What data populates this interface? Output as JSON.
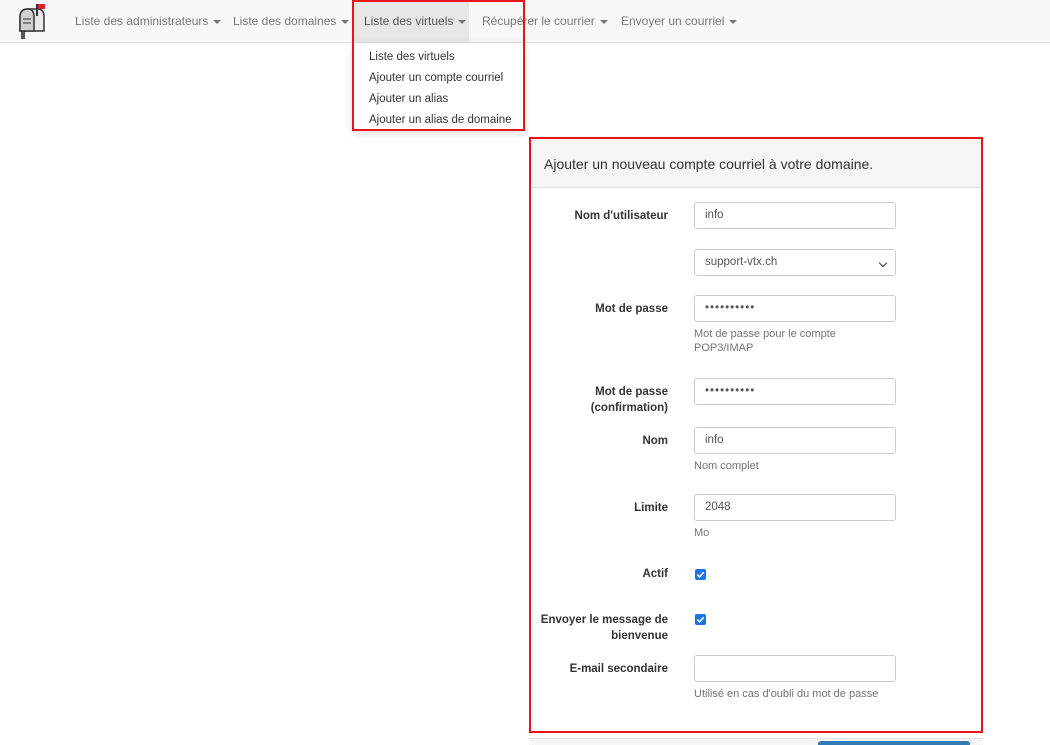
{
  "nav": {
    "items": [
      {
        "label": "Liste des administrateurs"
      },
      {
        "label": "Liste des domaines"
      },
      {
        "label": "Liste des virtuels"
      },
      {
        "label": "Récupérer le courrier"
      },
      {
        "label": "Envoyer un courriel"
      }
    ],
    "dropdown": [
      {
        "label": "Liste des virtuels"
      },
      {
        "label": "Ajouter un compte courriel"
      },
      {
        "label": "Ajouter un alias"
      },
      {
        "label": "Ajouter un alias de domaine"
      }
    ]
  },
  "form": {
    "title": "Ajouter un nouveau compte courriel à votre domaine.",
    "username": {
      "label": "Nom d'utilisateur",
      "value": "info"
    },
    "domain": {
      "value": "support-vtx.ch"
    },
    "password": {
      "label": "Mot de passe",
      "value": "••••••••••",
      "help": "Mot de passe pour le compte POP3/IMAP"
    },
    "password_confirm": {
      "label": "Mot de passe (confirmation)",
      "value": "••••••••••"
    },
    "name": {
      "label": "Nom",
      "value": "info",
      "help": "Nom complet"
    },
    "quota": {
      "label": "Limite",
      "value": "2048",
      "help": "Mo"
    },
    "active": {
      "label": "Actif",
      "checked": true
    },
    "welcome": {
      "label": "Envoyer le message de bienvenue",
      "checked": true
    },
    "secondary_email": {
      "label": "E-mail secondaire",
      "value": "",
      "help": "Utilisé en cas d'oubli du mot de passe"
    }
  },
  "colors": {
    "highlight": "#e8151b",
    "primary": "#337ab7",
    "checkbox": "#1a73e8"
  }
}
